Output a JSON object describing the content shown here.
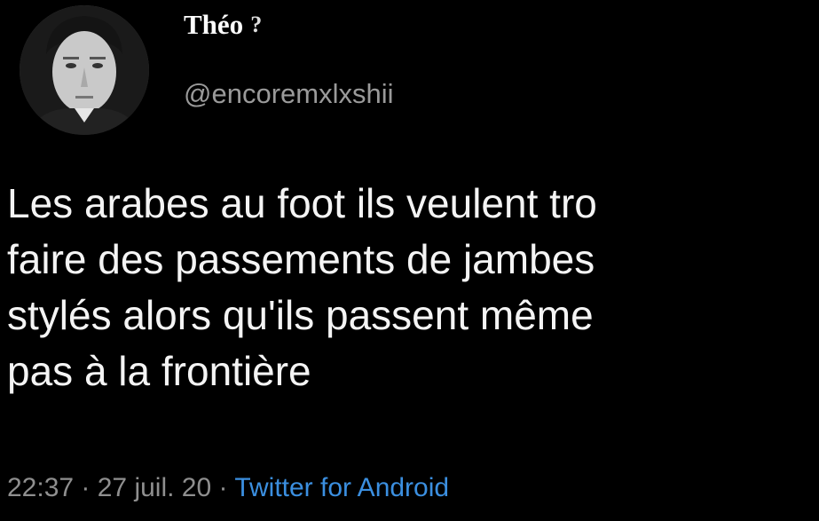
{
  "user": {
    "display_name": "Théo",
    "name_emoji": "?",
    "handle": "@encoremxlxshii"
  },
  "tweet": {
    "lines": [
      "Les arabes au foot ils veulent tro",
      "faire des passements de jambes",
      "stylés alors qu'ils passent même",
      "pas à la frontière"
    ],
    "time": "22:37",
    "separator1": " · ",
    "date": "27 juil. 20",
    "separator2": " · ",
    "source": "Twitter for Android"
  },
  "colors": {
    "background": "#000000",
    "text": "#f4f4f4",
    "muted": "#8f8f8f",
    "link": "#3b8fe0"
  }
}
